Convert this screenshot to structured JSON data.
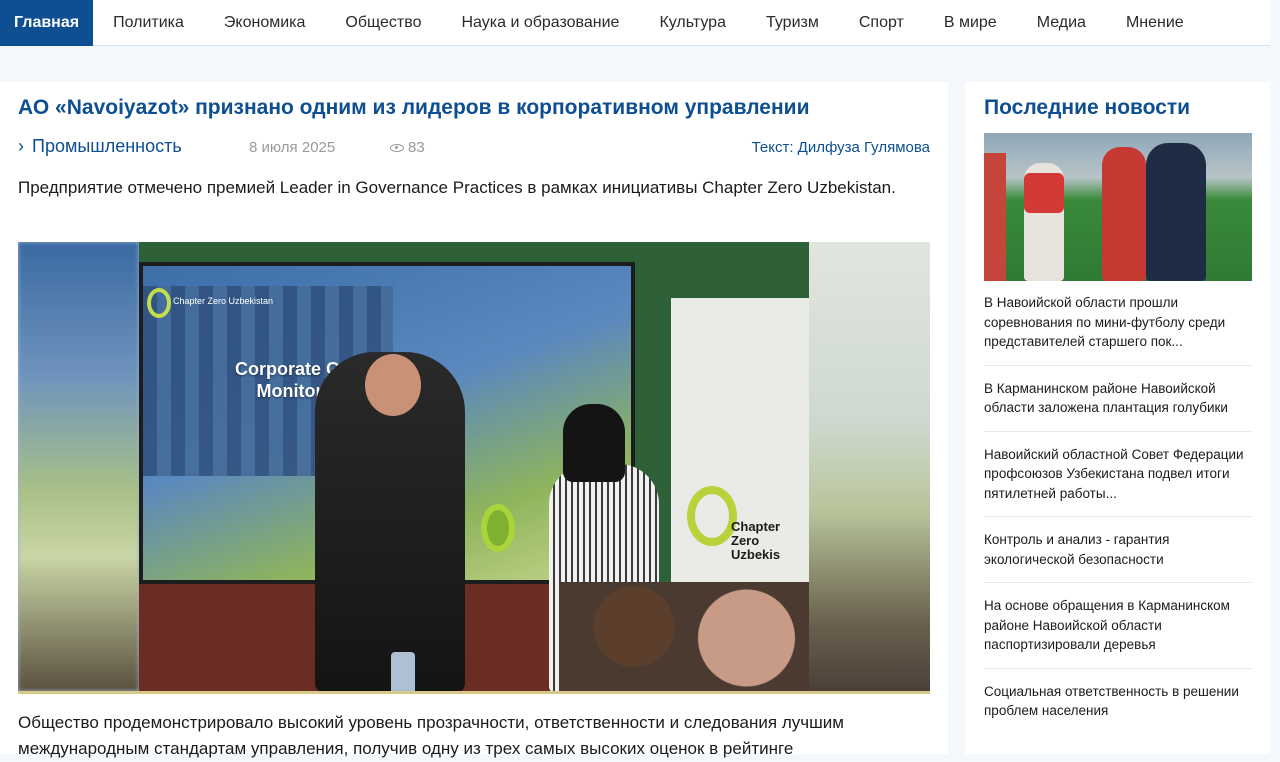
{
  "nav": {
    "items": [
      {
        "label": "Главная",
        "active": true
      },
      {
        "label": "Политика"
      },
      {
        "label": "Экономика"
      },
      {
        "label": "Общество"
      },
      {
        "label": "Наука и образование"
      },
      {
        "label": "Культура"
      },
      {
        "label": "Туризм"
      },
      {
        "label": "Спорт"
      },
      {
        "label": "В мире"
      },
      {
        "label": "Медиа"
      },
      {
        "label": "Мнение"
      }
    ]
  },
  "article": {
    "title": "АО «Navoiyazot» признано одним из лидеров в корпоративном управлении",
    "category": "Промышленность",
    "date": "8 июля 2025",
    "views": "83",
    "author": "Текст: Дилфуза Гулямова",
    "lead": "Предприятие отмечено премией Leader in Governance Practices в рамках инициативы Chapter Zero Uzbekistan.",
    "photo": {
      "screen_logo": "Chapter Zero Uzbekistan",
      "screen_heading_line1": "Corporate Governance",
      "screen_heading_line2": "Monitoring Award",
      "banner_line1": "Chapter",
      "banner_line2": "Zero Uzbekis"
    },
    "body": "Общество продемонстрировало высокий уровень прозрачности, ответственности и следования лучшим международным стандартам управления, получив одну из трех самых высоких оценок в рейтинге"
  },
  "sidebar": {
    "title": "Последние новости",
    "news": [
      {
        "text": "В Навоийской области прошли соревнования по мини-футболу среди представителей старшего пок..."
      },
      {
        "text": "В Карманинском районе Навоийской области заложена плантация голубики"
      },
      {
        "text": "Навоийский областной Совет Федерации профсоюзов Узбекистана подвел итоги пятилетней работы..."
      },
      {
        "text": "Контроль и анализ - гарантия экологической безопасности"
      },
      {
        "text": "На основе обращения в Карманинском районе Навоийской области паспортизировали деревья"
      },
      {
        "text": "Социальная ответственность в решении проблем населения"
      }
    ]
  },
  "colors": {
    "brand": "#0d4f91",
    "muted": "#9a9a9a",
    "background": "#f4f7fb"
  },
  "icons": {
    "category": "chevron-right-icon",
    "views": "eye-icon"
  }
}
